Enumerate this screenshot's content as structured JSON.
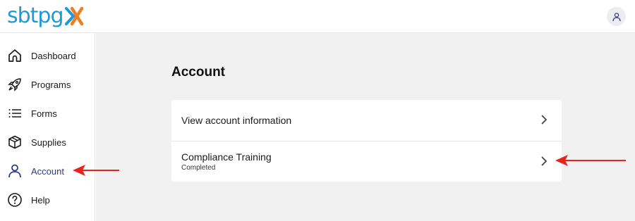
{
  "header": {
    "logo_text": "sbtpg",
    "logo_colors": {
      "text": "#1e9ad6",
      "x_orange": "#f07f23",
      "x_blue": "#1e9ad6"
    },
    "user_icon": "user-icon"
  },
  "sidebar": {
    "items": [
      {
        "label": "Dashboard",
        "icon": "home-icon"
      },
      {
        "label": "Programs",
        "icon": "rocket-icon"
      },
      {
        "label": "Forms",
        "icon": "list-icon"
      },
      {
        "label": "Supplies",
        "icon": "box-icon"
      },
      {
        "label": "Account",
        "icon": "user-icon",
        "active": true
      },
      {
        "label": "Help",
        "icon": "help-icon"
      }
    ],
    "active_color": "#2a3a8c"
  },
  "main": {
    "title": "Account",
    "rows": [
      {
        "title": "View account information"
      },
      {
        "title": "Compliance Training",
        "subtitle": "Completed"
      }
    ]
  },
  "annotations": {
    "arrow_color": "#e8231a"
  }
}
